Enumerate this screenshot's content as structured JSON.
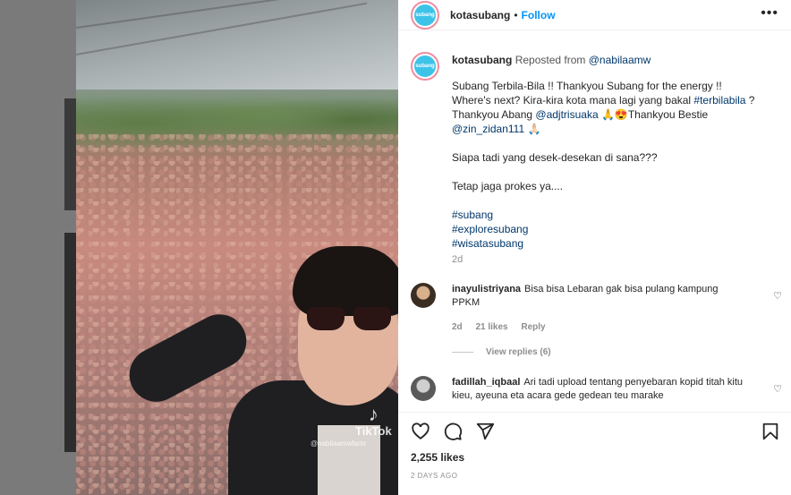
{
  "post": {
    "username": "kotasubang",
    "follow_label": "Follow",
    "more_label": "•••",
    "separator": "•",
    "avatar_text": "subang"
  },
  "media": {
    "watermark_app": "TikTok",
    "watermark_handle": "@nabilaamwfamr"
  },
  "caption": {
    "username": "kotasubang",
    "reposted_label": "Reposted from",
    "reposted_user": "@nabilaamw",
    "line1": "Subang Terbila-Bila !! Thankyou Subang for the energy !!",
    "line2a": "Where's next? Kira-kira kota mana lagi yang bakal ",
    "line2_tag": "#terbilabila",
    "line2b": " ?",
    "line3a": "Thankyou Abang ",
    "line3_mention": "@adjtrisuaka",
    "line3b": " 🙏😍Thankyou Bestie",
    "line4_mention": "@zin_zidan111",
    "line4b": " 🙏🏻",
    "para2": "Siapa tadi yang desek-desekan di sana???",
    "para3": "Tetap jaga prokes ya....",
    "tags": [
      "#subang",
      "#exploresubang",
      "#wisatasubang"
    ],
    "time": "2d"
  },
  "comments": [
    {
      "username": "inayulistriyana",
      "text": "Bisa bisa Lebaran gak bisa pulang kampung PPKM",
      "time": "2d",
      "likes": "21 likes",
      "reply": "Reply",
      "view_replies": "View replies (6)"
    },
    {
      "username": "fadillah_iqbaal",
      "text": "Ari tadi upload tentang penyebaran kopid titah kitu kieu, ayeuna eta acara gede gedean teu marake"
    }
  ],
  "actions": {
    "likes": "2,255 likes",
    "ago": "2 DAYS AGO"
  },
  "icons": [
    "heart-icon",
    "comment-icon",
    "share-icon",
    "bookmark-icon",
    "more-icon"
  ],
  "colors": {
    "link": "#00376b",
    "follow": "#0095f6",
    "accent_ring": "#f08ca0"
  }
}
